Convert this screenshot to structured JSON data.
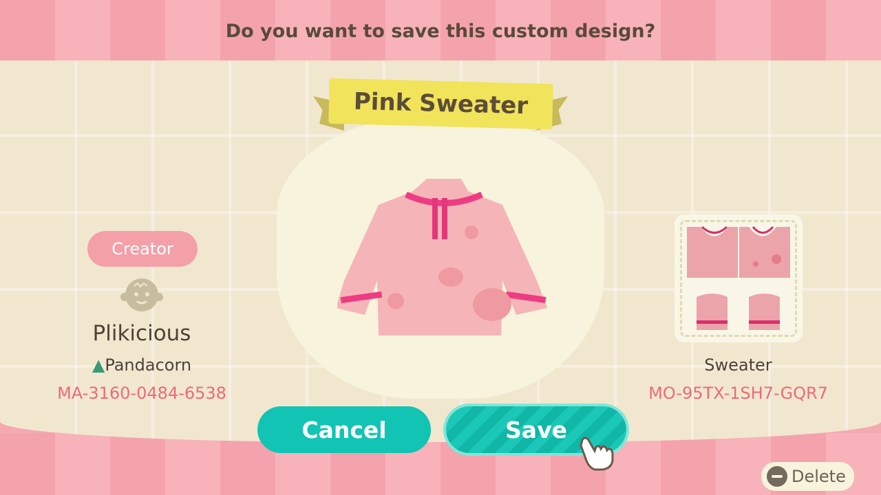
{
  "dialog": {
    "question": "Do you want to save this custom design?"
  },
  "design": {
    "title": "Pink Sweater",
    "type": "Sweater",
    "design_code": "MO-95TX-1SH7-GQR7"
  },
  "creator": {
    "label": "Creator",
    "name": "Plikicious",
    "island": "Pandacorn",
    "creator_code": "MA-3160-0484-6538"
  },
  "buttons": {
    "cancel": "Cancel",
    "save": "Save",
    "delete": "Delete"
  },
  "colors": {
    "accent": "#12c4b4",
    "code_text": "#ec6a7a",
    "banner": "#f1e35a",
    "background_pink": "#f5a9b0"
  }
}
